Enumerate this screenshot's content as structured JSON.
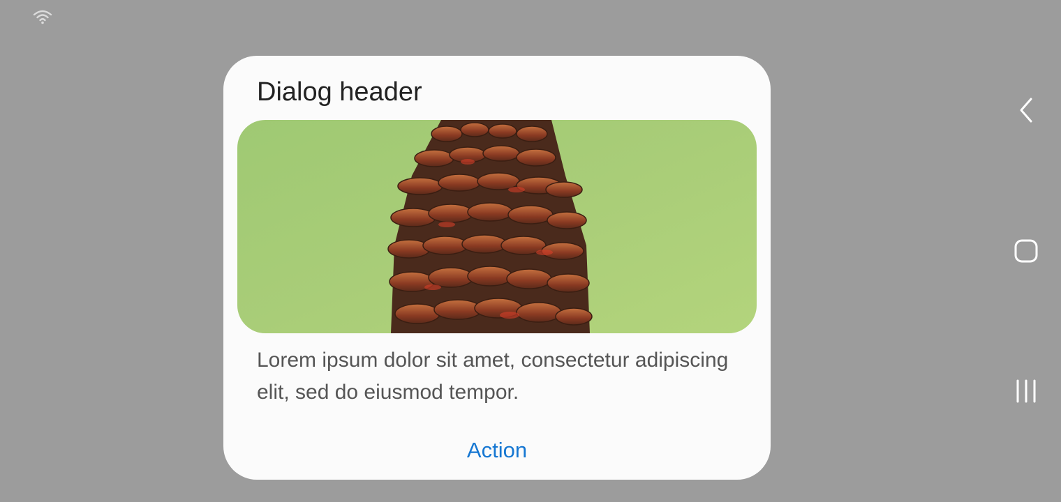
{
  "status_bar": {
    "wifi_icon": "wifi-icon"
  },
  "dialog": {
    "title": "Dialog header",
    "image": {
      "icon": "pinecone-image",
      "background_color": "#a9cd78"
    },
    "body": "Lorem ipsum dolor sit amet, consectetur adipiscing elit, sed do eiusmod tempor.",
    "action_label": "Action"
  },
  "navigation_bar": {
    "back_icon": "chevron-left-icon",
    "home_icon": "rounded-square-icon",
    "recents_icon": "three-bars-icon"
  },
  "colors": {
    "scrim": "#9c9c9c",
    "dialog_background": "#fbfbfb",
    "accent": "#1677d2",
    "title_text": "#222222",
    "body_text": "#555555"
  }
}
